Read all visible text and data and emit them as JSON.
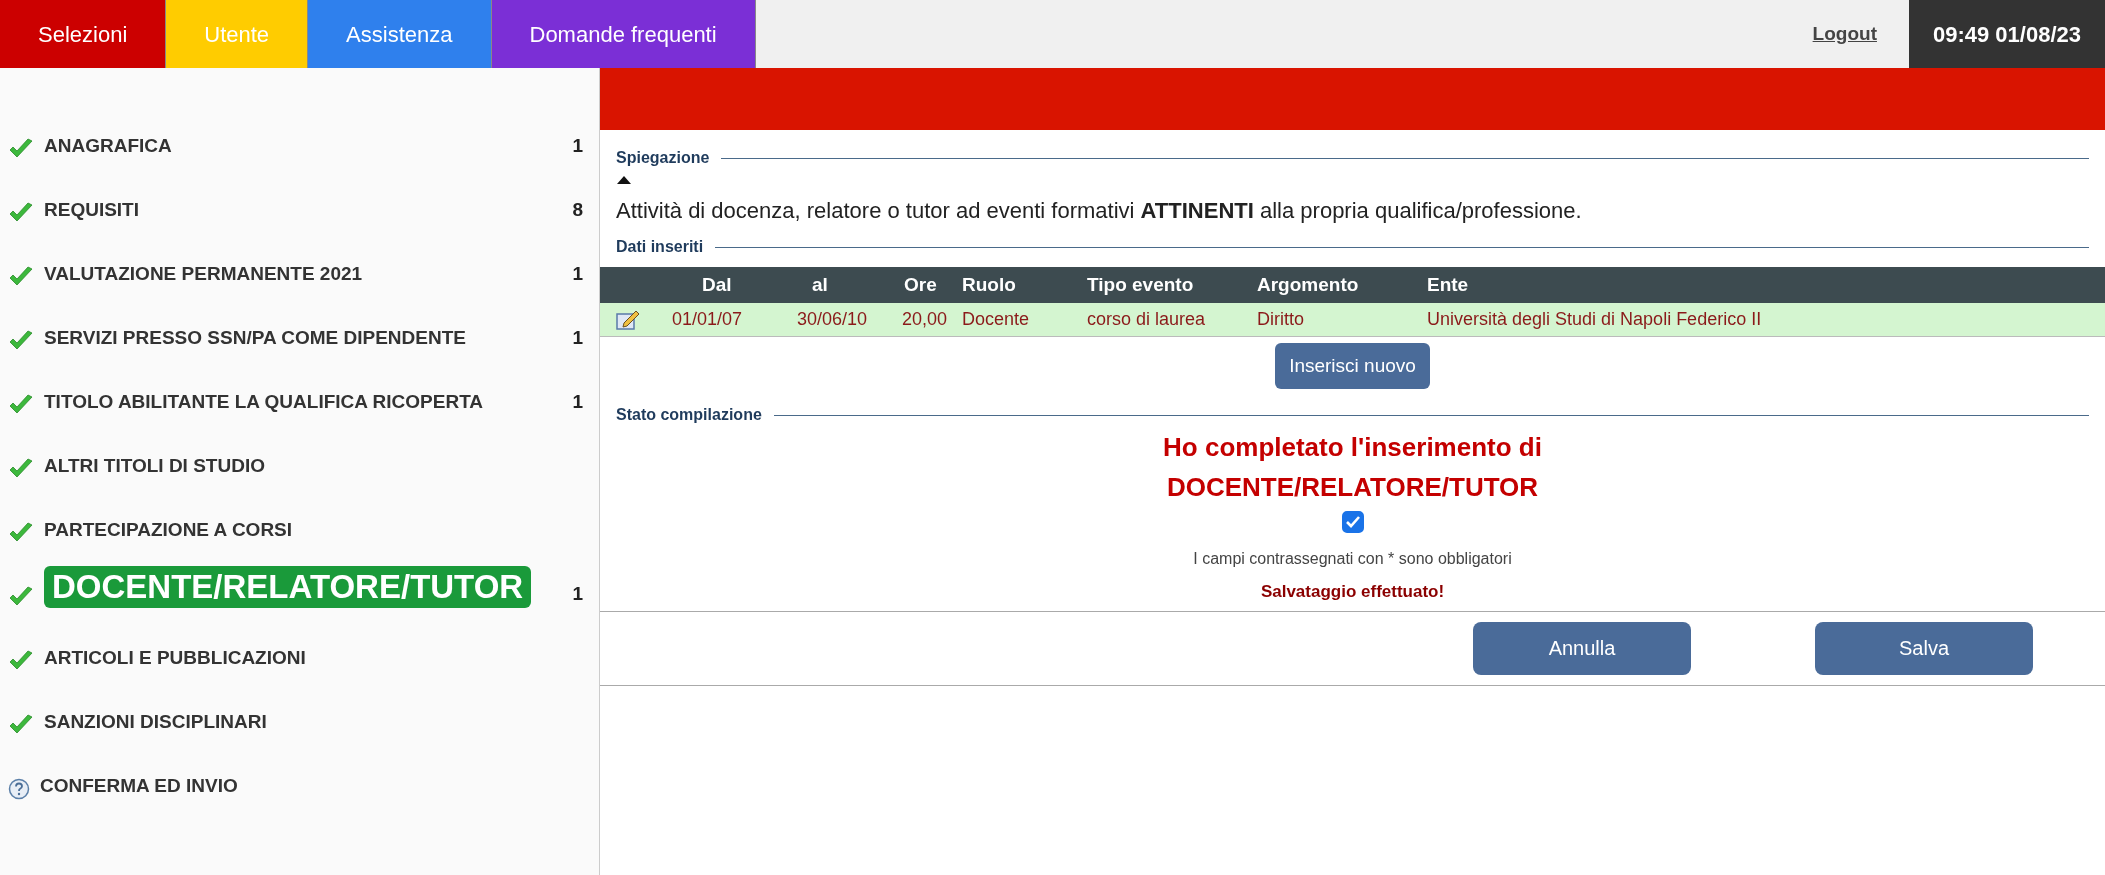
{
  "nav": {
    "tabs": [
      {
        "label": "Selezioni",
        "color": "#cc0000",
        "selected": false
      },
      {
        "label": "Utente",
        "color": "#ffcc00",
        "selected": false
      },
      {
        "label": "Assistenza",
        "color": "#2f80ed",
        "selected": false
      },
      {
        "label": "Domande frequenti",
        "color": "#7b2fd6",
        "selected": false
      }
    ],
    "logout": "Logout",
    "clock": "09:49 01/08/23"
  },
  "sidebar": {
    "items": [
      {
        "kind": "done",
        "label": "ANAGRAFICA",
        "count": "1",
        "selected": false
      },
      {
        "kind": "done",
        "label": "REQUISITI",
        "count": "8",
        "selected": false
      },
      {
        "kind": "done",
        "label": "VALUTAZIONE PERMANENTE 2021",
        "count": "1",
        "selected": false
      },
      {
        "kind": "done",
        "label": "SERVIZI PRESSO SSN/PA COME DIPENDENTE",
        "count": "1",
        "selected": false
      },
      {
        "kind": "done",
        "label": "TITOLO ABILITANTE LA QUALIFICA RICOPERTA",
        "count": "1",
        "selected": false
      },
      {
        "kind": "done",
        "label": "ALTRI TITOLI DI STUDIO",
        "selected": false
      },
      {
        "kind": "done",
        "label": "PARTECIPAZIONE A CORSI",
        "selected": false
      },
      {
        "kind": "done",
        "label": "DOCENTE/RELATORE/TUTOR",
        "count": "1",
        "selected": true
      },
      {
        "kind": "done",
        "label": "ARTICOLI E PUBBLICAZIONI",
        "selected": false
      },
      {
        "kind": "done",
        "label": "SANZIONI DISCIPLINARI",
        "selected": false
      },
      {
        "kind": "pending",
        "label": "CONFERMA ED INVIO",
        "selected": false
      }
    ]
  },
  "explanation": {
    "legend": "Spiegazione",
    "expanded": true,
    "text": "Attività di docenza, relatore o tutor ad eventi formativi **ATTINENTI** alla propria qualifica/professione."
  },
  "entries": {
    "legend": "Dati inseriti",
    "columns": [
      "Dal",
      "al",
      "Ore",
      "Ruolo",
      "Tipo evento",
      "Argomento",
      "Ente"
    ],
    "rows": [
      [
        "01/01/07",
        "30/06/10",
        "20,00",
        "Docente",
        "corso di laurea",
        "Diritto",
        "Università degli Studi di Napoli Federico II"
      ]
    ],
    "add_button": "Inserisci nuovo"
  },
  "status": {
    "legend": "Stato compilazione",
    "title_line_1": "Ho completato l'inserimento di",
    "title_line_2": "DOCENTE/RELATORE/TUTOR",
    "checked": true,
    "note": "I campi contrassegnati con * sono obbligatori",
    "message": "Salvataggio effettuato!"
  },
  "buttons": [
    "Annulla",
    "Salva"
  ]
}
